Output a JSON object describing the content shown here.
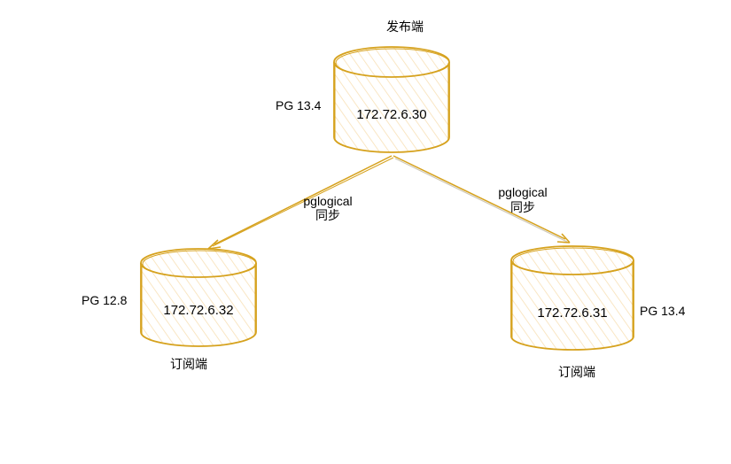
{
  "colors": {
    "stroke": "#d6a21e",
    "hatch": "#f3c77a",
    "text": "#000000"
  },
  "publisher": {
    "role": "发布端",
    "version": "PG 13.4",
    "ip": "172.72.6.30"
  },
  "subscriber_left": {
    "role": "订阅端",
    "version": "PG 12.8",
    "ip": "172.72.6.32"
  },
  "subscriber_right": {
    "role": "订阅端",
    "version": "PG 13.4",
    "ip": "172.72.6.31"
  },
  "edge_left": {
    "line1": "pglogical",
    "line2": "同步"
  },
  "edge_right": {
    "line1": "pglogical",
    "line2": "同步"
  }
}
